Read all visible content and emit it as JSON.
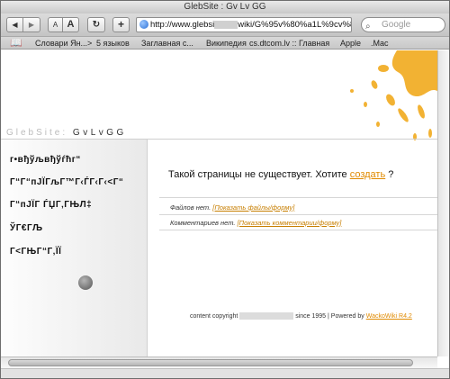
{
  "window": {
    "title": "GlebSite : Gv Lv GG"
  },
  "toolbar": {
    "back_glyph": "◀",
    "forward_glyph": "▶",
    "font_small": "A",
    "font_large": "A",
    "reload_glyph": "↻",
    "add_glyph": "+",
    "address_prefix": "http://www.glebsi",
    "address_suffix": "wiki/G%95v%80%a1L%9cv%8",
    "search_placeholder": "Google"
  },
  "bookmarks": {
    "items": [
      "Словари Ян...>",
      "5 языков",
      "Заглавная с...",
      "Википедия",
      "cs.dtcom.lv :: Главная",
      "Apple",
      ".Mac"
    ]
  },
  "site": {
    "title_gray": "GlebSite:",
    "title_dark": "GvLvGG"
  },
  "nav": {
    "items": [
      "г•вђўљвђўѓћг“",
      "Г“Г“пЈЇГљГ™Г‹ЃГ‹Г‹<Г“",
      "Г“пЈЇГ ЃЏГ‚ГЊЛ‡",
      "ЎГ€ГЉ",
      "Г<ГЊГ“Г‚ЇЇ"
    ]
  },
  "main": {
    "not_found_text": "Такой страницы не существует. Хотите",
    "create_link": "создать",
    "question_mark": "?",
    "files_label": "Файлов нет.",
    "files_link": "[Показать файлы/форму]",
    "comments_label": "Комментариев нет.",
    "comments_link": "[Показать комментарии/форму]"
  },
  "footer": {
    "copyright_prefix": "content copyright",
    "copyright_suffix": "since 1995 | Powered by",
    "powered_link": "WackoWiki R4.2"
  },
  "colors": {
    "accent": "#e08a00",
    "splash": "#f2b233"
  }
}
